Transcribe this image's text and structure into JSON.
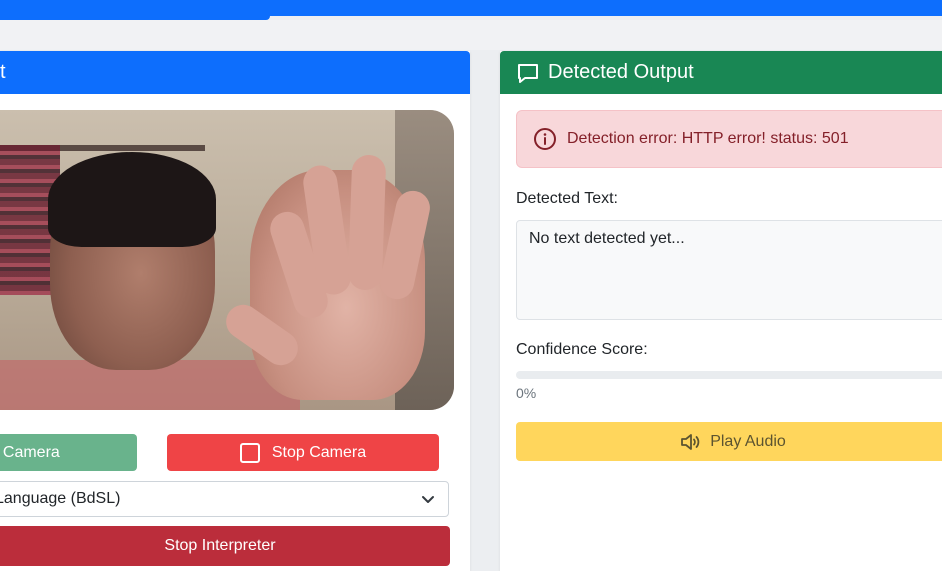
{
  "left_panel": {
    "header_title": "t",
    "start_camera_label": "t Camera",
    "stop_camera_label": "Stop Camera",
    "language_select_value": "Language (BdSL)",
    "stop_interpreter_label": "Stop Interpreter"
  },
  "right_panel": {
    "header_title": "Detected Output",
    "error_message": "Detection error: HTTP error! status: 501",
    "detected_text_label": "Detected Text:",
    "detected_text_value": "No text detected yet...",
    "confidence_label": "Confidence Score:",
    "confidence_value": 0,
    "confidence_text": "0%",
    "play_audio_label": "Play Audio"
  },
  "icons": {
    "output_header": "chat-square-icon",
    "error": "info-circle-icon",
    "stop_camera": "square-icon",
    "select": "chevron-down-icon",
    "audio": "volume-icon"
  },
  "colors": {
    "primary": "#0d6efd",
    "success": "#198754",
    "danger": "#ef4446",
    "interpreter": "#bb2d3b",
    "start": "#69b38c",
    "warning": "#ffd65c",
    "alert_bg": "#f8d7da",
    "alert_text": "#842029"
  }
}
